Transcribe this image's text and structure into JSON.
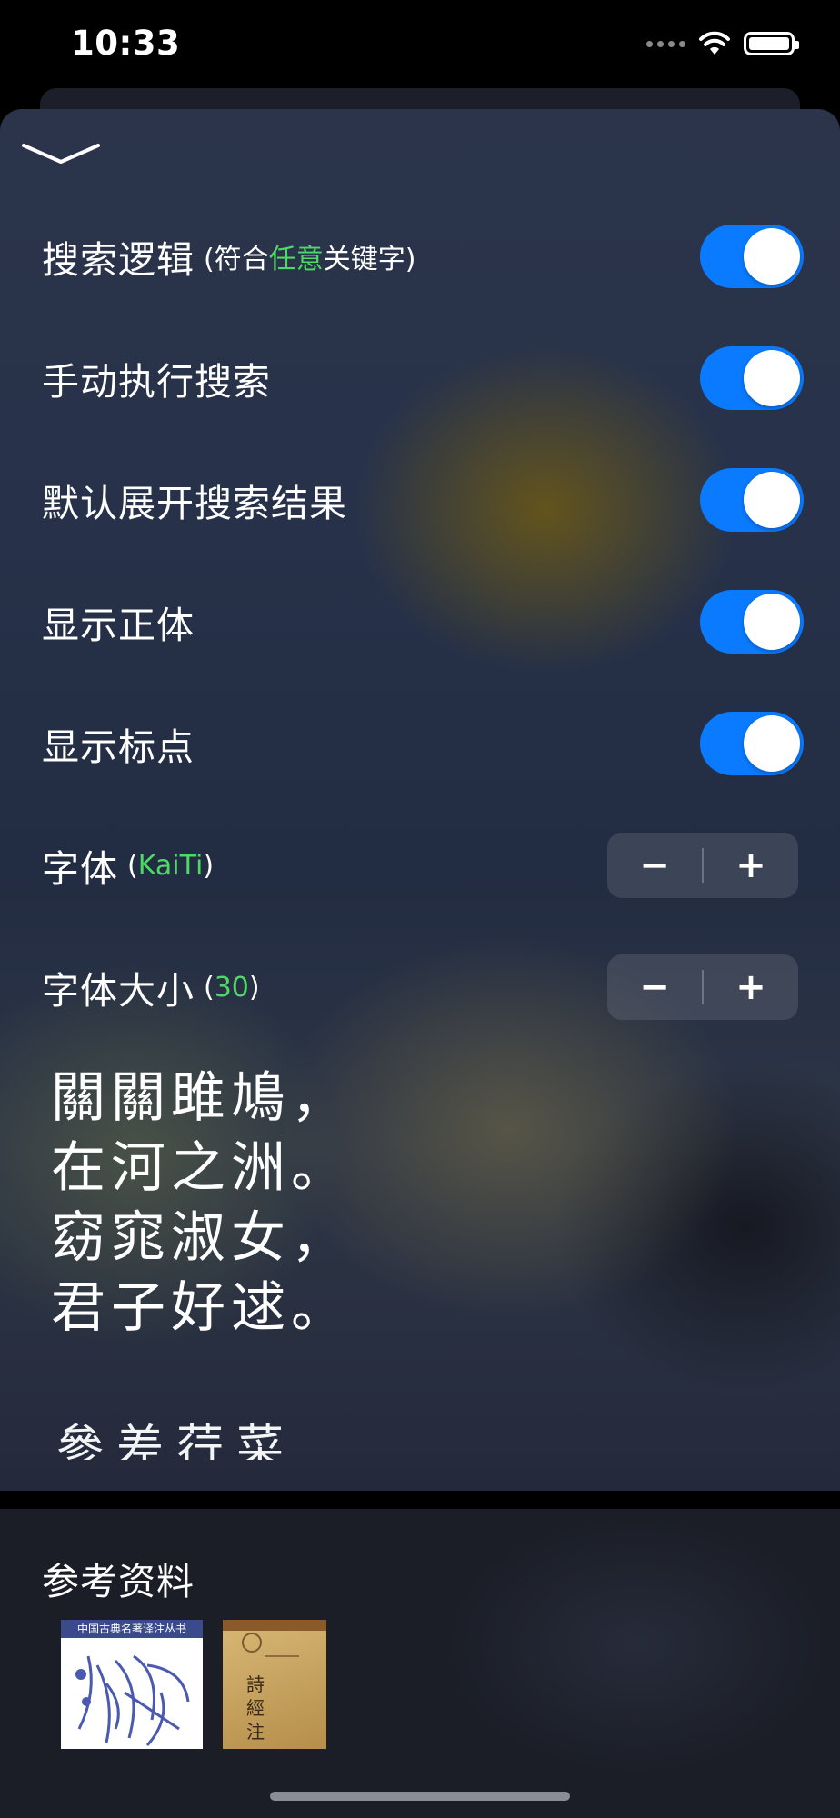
{
  "status_bar": {
    "time": "10:33"
  },
  "settings": {
    "search_logic": {
      "label": "搜索逻辑",
      "sub_open": "(符合",
      "sub_highlight": "任意",
      "sub_close": "关键字)",
      "on": true
    },
    "manual_search": {
      "label": "手动执行搜索",
      "on": true
    },
    "expand_results": {
      "label": "默认展开搜索结果",
      "on": true
    },
    "show_traditional": {
      "label": "显示正体",
      "on": true
    },
    "show_punctuation": {
      "label": "显示标点",
      "on": true
    },
    "font": {
      "label": "字体",
      "paren_open": "(",
      "value": "KaiTi",
      "paren_close": ")",
      "minus": "−",
      "plus": "+"
    },
    "font_size": {
      "label": "字体大小",
      "paren_open": "(",
      "value": "30",
      "paren_close": ")",
      "minus": "−",
      "plus": "+"
    }
  },
  "preview": {
    "lines": [
      "關關雎鳩，",
      "在河之洲。",
      "窈窕淑女，",
      "君子好逑。"
    ],
    "next_line": "參差荇菜"
  },
  "references": {
    "title": "参考资料",
    "book1_band": "中国古典名著译注丛书",
    "book2_title": "詩經注"
  },
  "colors": {
    "accent": "#0a7aff",
    "highlight": "#4cd964"
  }
}
